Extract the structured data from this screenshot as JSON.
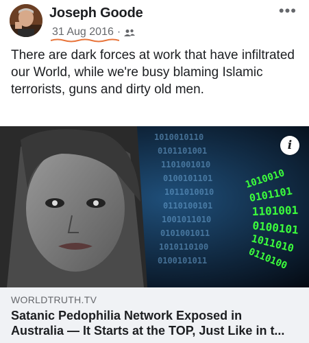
{
  "post": {
    "author": "Joseph Goode",
    "date": "31 Aug 2016",
    "separator": "·",
    "audience_icon": "friends-icon",
    "more_icon": "more-options-icon",
    "more_label": "•••",
    "text": "There are dark forces at work that have infiltrated our World, while we're busy blaming Islamic terrorists, guns and dirty old men."
  },
  "link": {
    "domain": "WORLDTRUTH.TV",
    "title_line1": "Satanic Pedophilia Network Exposed in",
    "title_line2": "Australia — It Starts at the TOP, Just Like in t...",
    "info_label": "i",
    "binary_text": "1010010110"
  },
  "colors": {
    "underline": "#e8743a",
    "meta_gray": "#65676b",
    "card_bg": "#f0f2f5",
    "binary_green": "#3cff3c"
  }
}
